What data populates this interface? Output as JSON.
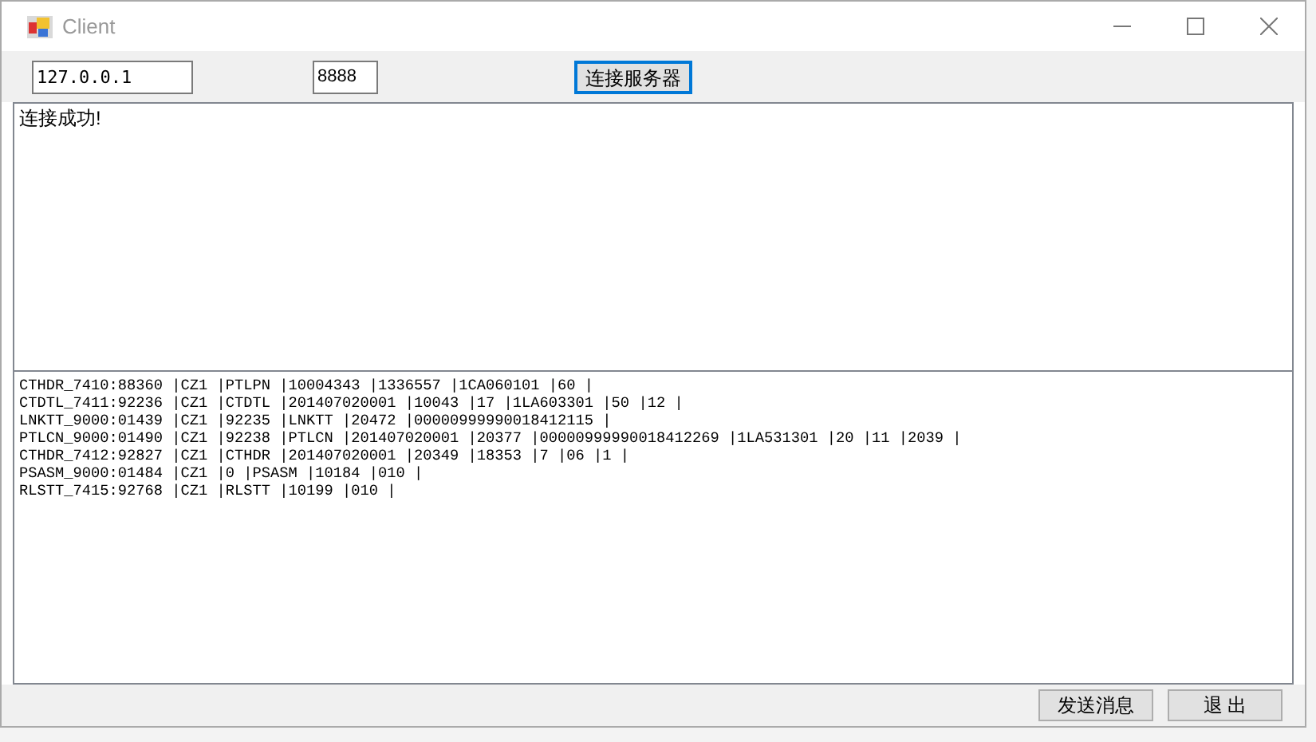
{
  "window": {
    "title": "Client"
  },
  "toolbar": {
    "host_field": {
      "value": "127.0.0.1"
    },
    "port_field": {
      "value": "8888"
    },
    "connect_button": {
      "label": "连接服务器",
      "focused": true
    }
  },
  "log_box": {
    "lines": [
      "连接成功!"
    ]
  },
  "data_box": {
    "lines": [
      "CTHDR_7410:88360 |CZ1 |PTLPN |10004343 |1336557 |1CA060101 |60 |",
      "CTDTL_7411:92236 |CZ1 |CTDTL |201407020001 |10043 |17 |1LA603301 |50 |12 |",
      "LNKTT_9000:01439 |CZ1 |92235 |LNKTT |20472 |00000999990018412115 |",
      "PTLCN_9000:01490 |CZ1 |92238 |PTLCN |201407020001 |20377 |00000999990018412269 |1LA531301 |20 |11 |2039 |",
      "CTHDR_7412:92827 |CZ1 |CTHDR |201407020001 |20349 |18353 |7 |06 |1 |",
      "PSASM_9000:01484 |CZ1 |0 |PSASM |10184 |010 |",
      "RLSTT_7415:92768 |CZ1 |RLSTT |10199 |010 |"
    ]
  },
  "buttons": [
    {
      "label": "发送消息"
    },
    {
      "label": "退 出"
    }
  ]
}
